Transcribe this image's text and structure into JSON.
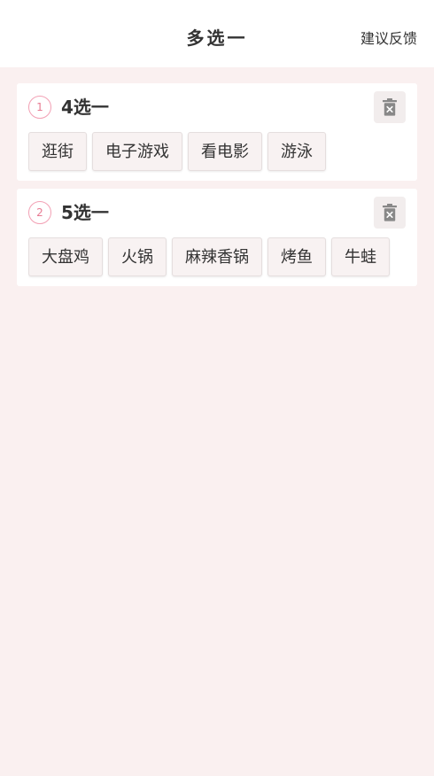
{
  "header": {
    "title": "多选一",
    "feedback_label": "建议反馈"
  },
  "groups": [
    {
      "index": "1",
      "title": "4选一",
      "options": [
        "逛街",
        "电子游戏",
        "看电影",
        "游泳"
      ]
    },
    {
      "index": "2",
      "title": "5选一",
      "options": [
        "大盘鸡",
        "火锅",
        "麻辣香锅",
        "烤鱼",
        "牛蛙"
      ]
    }
  ],
  "icons": {
    "delete": "trash-icon"
  },
  "colors": {
    "background": "#faf0f0",
    "badge_border": "#f2a0b4",
    "badge_text": "#e77a92",
    "chip_background": "#f8f2f2",
    "delete_button": "#f2eded",
    "icon": "#888888"
  }
}
